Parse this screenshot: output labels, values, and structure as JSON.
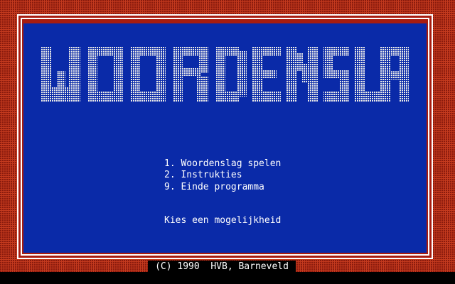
{
  "title": "WOORDENSLAG",
  "menu": {
    "item1": "1. Woordenslag spelen",
    "item2": "2. Instrukties",
    "item3": "9. Einde programma",
    "prompt": "Kies een mogelijkheid"
  },
  "footer": {
    "copyright": "(C) 1990  HVB, Barneveld"
  },
  "colors": {
    "background_panel": "#0a2aa8",
    "border_red": "#c43a1e",
    "text": "#ffffff"
  }
}
